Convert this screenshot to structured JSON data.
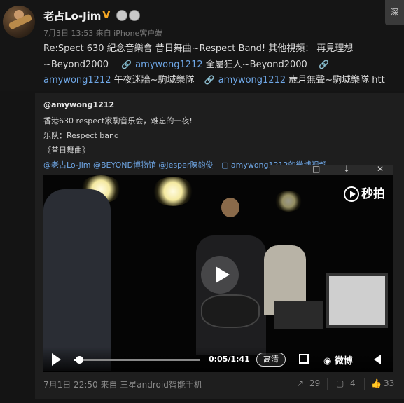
{
  "post": {
    "username": "老占Lo-Jim",
    "timestamp": "7月3日 13:53 来自 iPhone客户端",
    "text_line1": "Re:Spect 630 紀念音樂會 昔日舞曲~Respect Band!  其他視頻：  再見理想",
    "text_line2_prefix": "~Beyond2000",
    "link1_user": "amywong1212",
    "link1_title": "狂人~Beyond2000",
    "link1_title_pre": "全屬",
    "link2_user": "amywong1212",
    "link2_title": "午夜迷牆~駒域樂隊",
    "link3_user": "amywong1212",
    "link3_title": "歲月無聲~駒域樂隊 htt"
  },
  "corner_button": "深",
  "repost": {
    "user": "@amywong1212",
    "line1": "香港630 respect家駒音乐会，难忘的一夜!",
    "line2": "乐队：Respect band",
    "line3": "《昔日舞曲》",
    "mentions": "@老占Lo-Jim @BEYOND博物馆 @Jesper陳鈞俊",
    "video_link": "amywong1212的微博视频"
  },
  "video": {
    "brand": "秒拍",
    "time": "0:05/1:41",
    "quality": "高清",
    "weibo_logo": "微博",
    "progress": 0.04
  },
  "footer": {
    "source": "7月1日 22:50 来自 三星android智能手机",
    "forward_count": "29",
    "comment_count": "4",
    "like_count": "33"
  },
  "icons": {
    "verified": "v-badge-icon",
    "link": "link-icon",
    "video": "video-icon"
  },
  "colors": {
    "link": "#6fa7e6",
    "background": "#141414",
    "verified": "#f5a623"
  }
}
